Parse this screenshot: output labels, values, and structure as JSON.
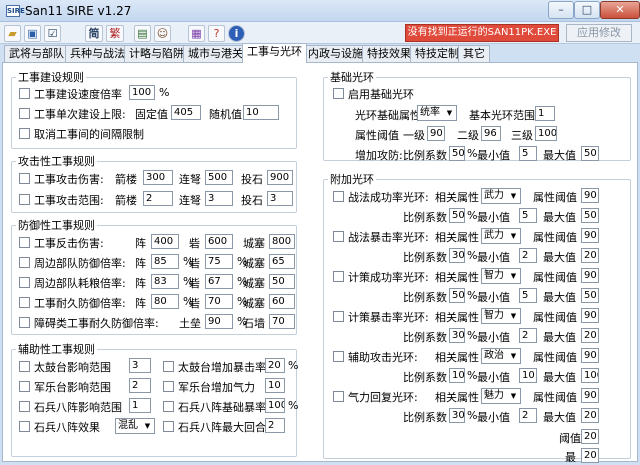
{
  "title": "San11 SIRE v1.27",
  "logo": "SIRE",
  "window_buttons": {
    "min": "–",
    "max": "□",
    "close": "✕"
  },
  "toolbar": {
    "simplified": "简",
    "traditional": "繁"
  },
  "status": "没有找到正运行的SAN11PK.EXE",
  "apply": "应用修改",
  "tabs": [
    "武将与部队",
    "兵种与战法",
    "计略与陷阱",
    "城市与港关",
    "工事与光环",
    "内政与设施",
    "特技效果",
    "特技定制",
    "其它"
  ],
  "build": {
    "legend": "工事建设规则",
    "speed": "工事建设速度倍率",
    "speed_val": "100",
    "pct": "%",
    "limit": "工事单次建设上限:",
    "fixed": "固定值",
    "fixed_val": "405",
    "rand": "随机值",
    "rand_val": "10",
    "cancel": "取消工事间的间隔限制"
  },
  "attack": {
    "legend": "攻击性工事规则",
    "dmg": "工事攻击伤害:",
    "range": "工事攻击范围:",
    "arrow": "箭楼",
    "crossbow": "连弩",
    "stone": "投石",
    "dmg_vals": [
      "300",
      "500",
      "900"
    ],
    "range_vals": [
      "2",
      "3",
      "3"
    ]
  },
  "defense": {
    "legend": "防御性工事规则",
    "rows": [
      {
        "label": "工事反击伤害:",
        "a": "阵",
        "b": "砦",
        "c": "城塞",
        "v": [
          "400",
          "600",
          "800"
        ],
        "pct": false
      },
      {
        "label": "周边部队防御倍率:",
        "a": "阵",
        "b": "砦",
        "c": "城塞",
        "v": [
          "85",
          "75",
          "65"
        ],
        "pct": true
      },
      {
        "label": "周边部队耗粮倍率:",
        "a": "阵",
        "b": "砦",
        "c": "城塞",
        "v": [
          "83",
          "67",
          "50"
        ],
        "pct": true
      },
      {
        "label": "工事耐久防御倍率:",
        "a": "阵",
        "b": "砦",
        "c": "城塞",
        "v": [
          "80",
          "70",
          "60"
        ],
        "pct": true
      },
      {
        "label": "障碍类工事耐久防御倍率:",
        "a": "",
        "b": "土垒",
        "c": "石墙",
        "v": [
          "",
          "90",
          "70"
        ],
        "pct": true
      }
    ]
  },
  "aux": {
    "legend": "辅助性工事规则",
    "left": [
      {
        "label": "太鼓台影响范围",
        "val": "3"
      },
      {
        "label": "军乐台影响范围",
        "val": "2"
      },
      {
        "label": "石兵八阵影响范围",
        "val": "1"
      },
      {
        "label": "石兵八阵效果",
        "val": "混乱"
      }
    ],
    "right": [
      {
        "label": "太鼓台增加暴击率",
        "val": "20",
        "unit": "%"
      },
      {
        "label": "军乐台增加气力",
        "val": "10",
        "unit": ""
      },
      {
        "label": "石兵八阵基础暴率",
        "val": "100",
        "unit": "%"
      },
      {
        "label": "石兵八阵最大回合",
        "val": "2",
        "unit": ""
      }
    ]
  },
  "aura": {
    "legend": "基础光环",
    "enable": "启用基础光环",
    "attr": "光环基础属性",
    "attr_val": "统率",
    "range": "基本光环范围",
    "range_val": "1",
    "threshold": "属性阈值",
    "lv1": "一级",
    "lv1_val": "90",
    "lv2": "二级",
    "lv2_val": "96",
    "lv3": "三级",
    "lv3_val": "100",
    "inc": "增加攻防:",
    "ratio": "比例系数",
    "ratio_val": "50",
    "min": "最小值",
    "min_val": "5",
    "max": "最大值",
    "max_val": "50"
  },
  "extra": {
    "legend": "附加光环",
    "attr": "相关属性",
    "thr": "属性阈值",
    "ratio": "比例系数",
    "min": "最小值",
    "max": "最大值",
    "rows": [
      {
        "label": "战法成功率光环:",
        "attr": "武力",
        "thr": "90",
        "ratio": "50",
        "min": "5",
        "max": "50"
      },
      {
        "label": "战法暴击率光环:",
        "attr": "武力",
        "thr": "90",
        "ratio": "30",
        "min": "2",
        "max": "20"
      },
      {
        "label": "计策成功率光环:",
        "attr": "智力",
        "thr": "90",
        "ratio": "50",
        "min": "5",
        "max": "50"
      },
      {
        "label": "计策暴击率光环:",
        "attr": "智力",
        "thr": "90",
        "ratio": "30",
        "min": "2",
        "max": "20"
      },
      {
        "label": "辅助攻击光环:",
        "attr": "政治",
        "thr": "90",
        "ratio": "100",
        "min": "10",
        "max": "100"
      },
      {
        "label": "气力回复光环:",
        "attr": "魅力",
        "thr": "90",
        "ratio": "30",
        "min": "2",
        "max": "20"
      }
    ],
    "tail_thr": "阈值",
    "tail_thr_val": "20",
    "tail_min": "最",
    "tail_min_val": "20"
  }
}
